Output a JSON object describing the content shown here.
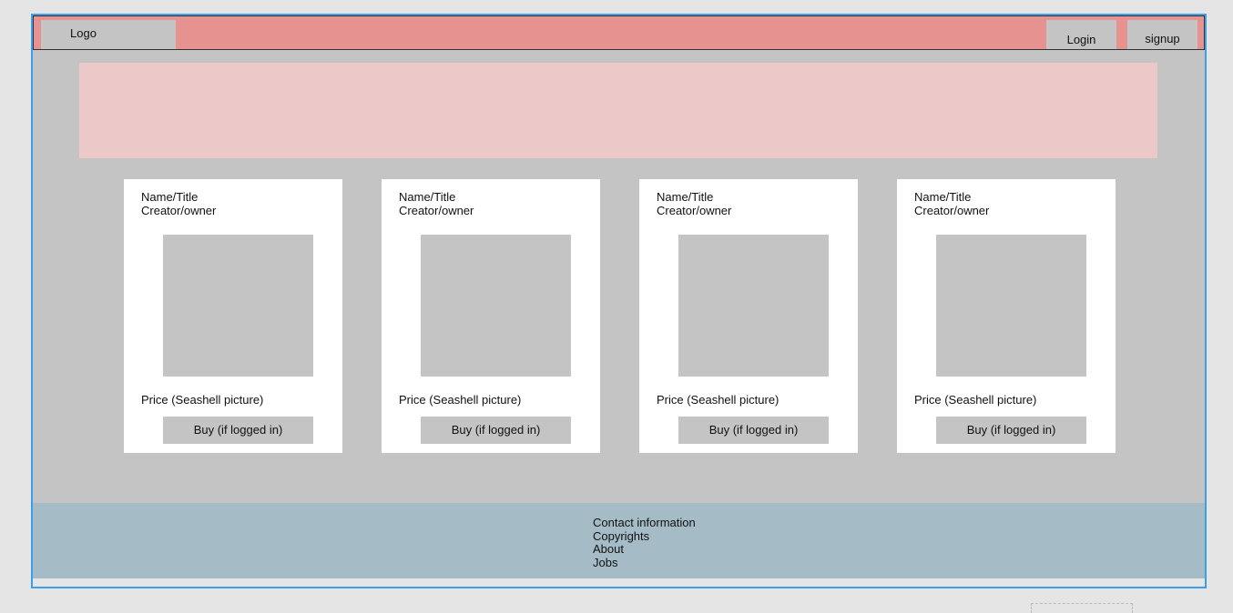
{
  "header": {
    "logo_label": "Logo",
    "login_label": "Login",
    "signup_label": "signup"
  },
  "cards": [
    {
      "title": "Name/Title",
      "creator": "Creator/owner",
      "price": "Price (Seashell picture)",
      "buy_label": "Buy (if logged in)"
    },
    {
      "title": "Name/Title",
      "creator": "Creator/owner",
      "price": "Price (Seashell picture)",
      "buy_label": "Buy (if logged in)"
    },
    {
      "title": "Name/Title",
      "creator": "Creator/owner",
      "price": "Price (Seashell picture)",
      "buy_label": "Buy (if logged in)"
    },
    {
      "title": "Name/Title",
      "creator": "Creator/owner",
      "price": "Price (Seashell picture)",
      "buy_label": "Buy (if logged in)"
    }
  ],
  "footer": {
    "links": [
      "Contact information",
      "Copyrights",
      "About",
      "Jobs"
    ]
  },
  "colors": {
    "header_bg": "#e69291",
    "hero_bg": "#ecc9c8",
    "footer_bg": "#a5bcc7",
    "frame_border": "#3aa0ea",
    "placeholder": "#c4c4c4"
  }
}
